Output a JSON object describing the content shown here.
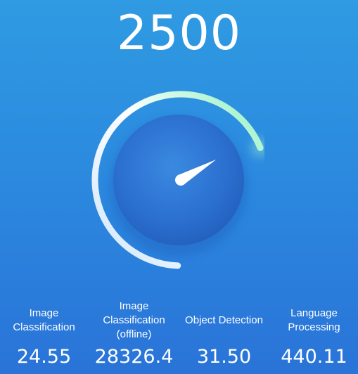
{
  "score": "2500",
  "gauge": {
    "level": 0.82
  },
  "metrics": [
    {
      "label": "Image Classification",
      "value": "24.55"
    },
    {
      "label": "Image Classification (offline)",
      "value": "28326.4"
    },
    {
      "label": "Object Detection",
      "value": "31.50"
    },
    {
      "label": "Language Processing",
      "value": "440.11"
    }
  ]
}
